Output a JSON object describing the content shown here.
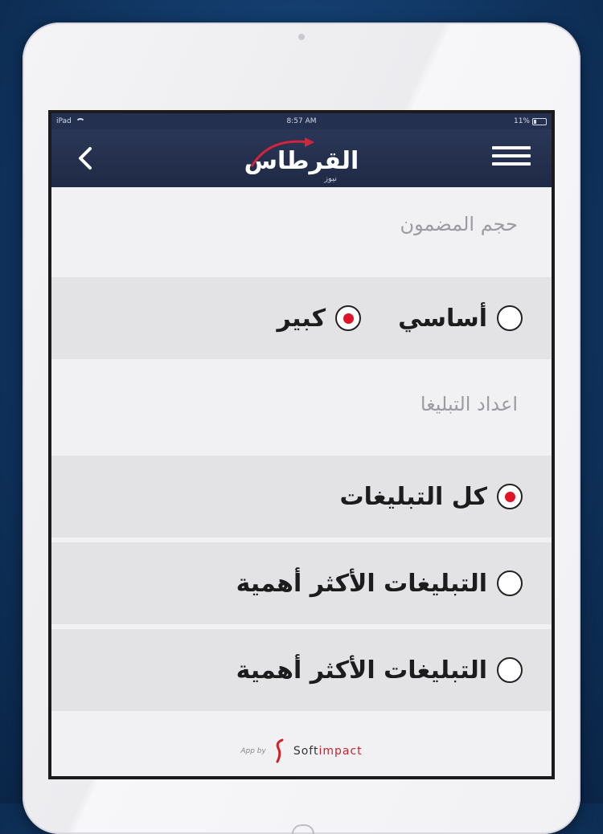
{
  "statusbar": {
    "device": "iPad",
    "time": "8:57 AM",
    "battery": "11%"
  },
  "navbar": {
    "logo_text": "القرطاس",
    "logo_subtext": "نيوز",
    "back_icon": "chevron-left-icon",
    "menu_icon": "hamburger-menu-icon"
  },
  "sections": {
    "content_size": {
      "title": "حجم المضمون",
      "options": [
        {
          "label": "أساسي",
          "checked": false
        },
        {
          "label": "كبير",
          "checked": true
        }
      ]
    },
    "notifications": {
      "title": "اعداد التبليغا",
      "options": [
        {
          "label": "كل التبليغات",
          "checked": true
        },
        {
          "label": "التبليغات الأكثر أهمية",
          "checked": false
        },
        {
          "label": "التبليغات الأكثر أهمية",
          "checked": false
        }
      ]
    }
  },
  "footer": {
    "app_by": "App by",
    "brand_prefix": "Soft",
    "brand_suffix": "impact"
  },
  "colors": {
    "navbar": "#23304f",
    "accent": "#e01424",
    "background": "#f1f1f3",
    "row": "#e3e3e6"
  }
}
